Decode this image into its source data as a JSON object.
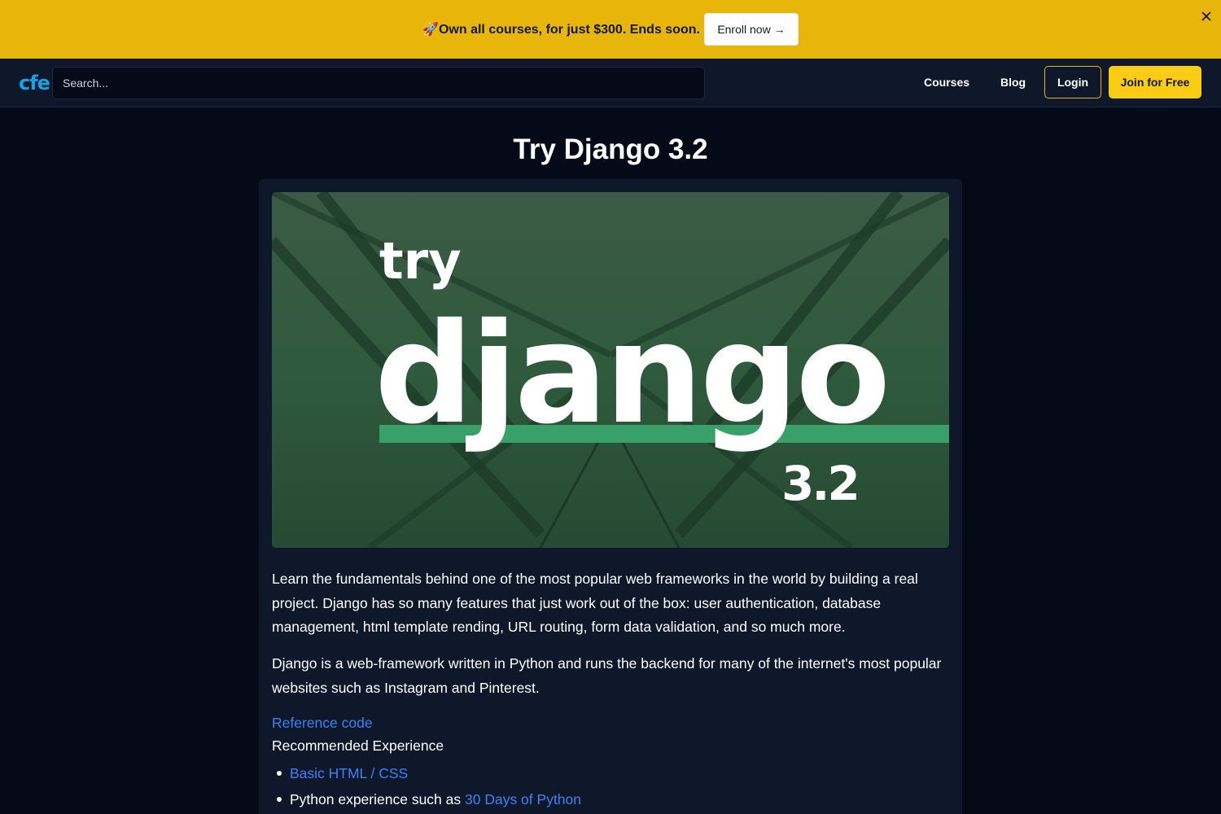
{
  "promo": {
    "text": "🚀Own all courses, for just $300. Ends soon.",
    "button_label": "Enroll now →",
    "close_icon": "close-icon"
  },
  "nav": {
    "logo": "cfe",
    "search_placeholder": "Search...",
    "links": [
      "Courses",
      "Blog"
    ],
    "login_label": "Login",
    "join_label": "Join for Free"
  },
  "page": {
    "title": "Try Django 3.2",
    "hero_image": {
      "word_top": "try",
      "word_main": "django",
      "version": "3.2"
    },
    "description_1": "Learn the fundamentals behind one of the most popular web frameworks in the world by building a real project. Django has so many features that just work out of the box: user authentication, database management, html template rending, URL routing, form data validation, and so much more.",
    "description_2": "Django is a web-framework written in Python and runs the backend for many of the internet's most popular websites such as Instagram and Pinterest.",
    "reference_link": "Reference code",
    "recommended_heading": "Recommended Experience",
    "recommended": [
      {
        "prefix": "",
        "link": "Basic HTML / CSS"
      },
      {
        "prefix": "Python experience such as ",
        "link": "30 Days of Python"
      }
    ]
  },
  "colors": {
    "banner": "#e8b50b",
    "accent_link": "#3b82f6",
    "join_button": "#facc15",
    "hero_stripe": "#3aa06a"
  }
}
